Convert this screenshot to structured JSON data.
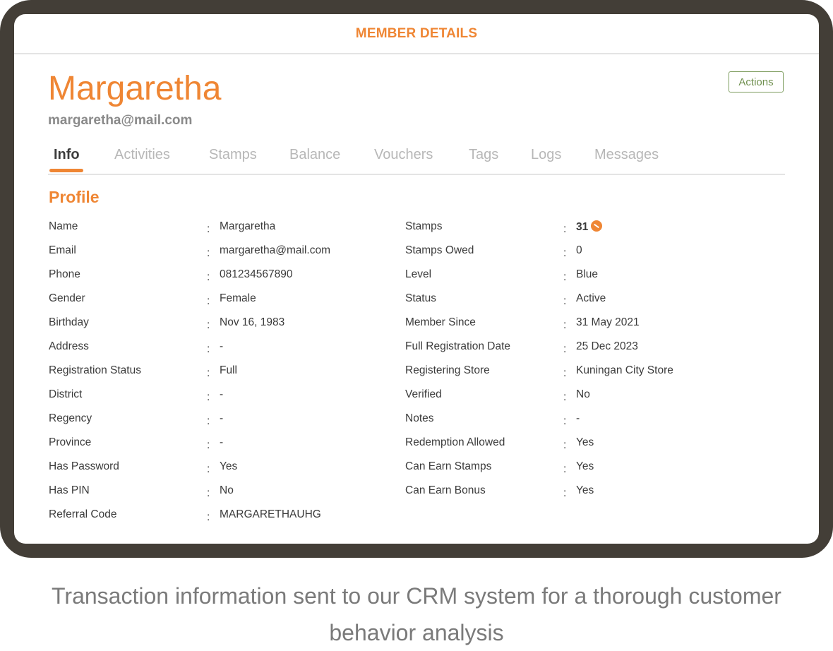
{
  "header": {
    "title": "MEMBER DETAILS"
  },
  "member": {
    "name": "Margaretha",
    "email": "margaretha@mail.com"
  },
  "actions_label": "Actions",
  "tabs": [
    {
      "label": "Info",
      "active": true
    },
    {
      "label": "Activities"
    },
    {
      "label": "Stamps"
    },
    {
      "label": "Balance"
    },
    {
      "label": "Vouchers"
    },
    {
      "label": "Tags"
    },
    {
      "label": "Logs"
    },
    {
      "label": "Messages"
    }
  ],
  "profile": {
    "title": "Profile",
    "separator": ":",
    "left": [
      {
        "label": "Name",
        "value": "Margaretha"
      },
      {
        "label": "Email",
        "value": "margaretha@mail.com"
      },
      {
        "label": "Phone",
        "value": "081234567890"
      },
      {
        "label": "Gender",
        "value": "Female"
      },
      {
        "label": "Birthday",
        "value": "Nov 16, 1983"
      },
      {
        "label": "Address",
        "value": "-"
      },
      {
        "label": "Registration Status",
        "value": "Full"
      },
      {
        "label": "District",
        "value": "-"
      },
      {
        "label": "Regency",
        "value": "-"
      },
      {
        "label": "Province",
        "value": "-"
      },
      {
        "label": "Has Password",
        "value": "Yes"
      },
      {
        "label": "Has PIN",
        "value": "No"
      },
      {
        "label": "Referral Code",
        "value": "MARGARETHAUHG"
      }
    ],
    "right": [
      {
        "label": "Stamps",
        "value": "31",
        "icon": "stamp-icon"
      },
      {
        "label": "Stamps Owed",
        "value": "0"
      },
      {
        "label": "Level",
        "value": "Blue"
      },
      {
        "label": "Status",
        "value": "Active"
      },
      {
        "label": "Member Since",
        "value": "31 May 2021"
      },
      {
        "label": "Full Registration Date",
        "value": "25 Dec 2023"
      },
      {
        "label": "Registering Store",
        "value": "Kuningan City Store"
      },
      {
        "label": "Verified",
        "value": "No"
      },
      {
        "label": "Notes",
        "value": "-"
      },
      {
        "label": "Redemption Allowed",
        "value": "Yes"
      },
      {
        "label": "Can Earn Stamps",
        "value": "Yes"
      },
      {
        "label": "Can Earn Bonus",
        "value": "Yes"
      }
    ]
  },
  "caption": "Transaction information sent to our CRM system for a thorough customer behavior analysis",
  "colors": {
    "accent": "#ef8634",
    "frame": "#433e37",
    "actions_border": "#7d9c5e"
  }
}
